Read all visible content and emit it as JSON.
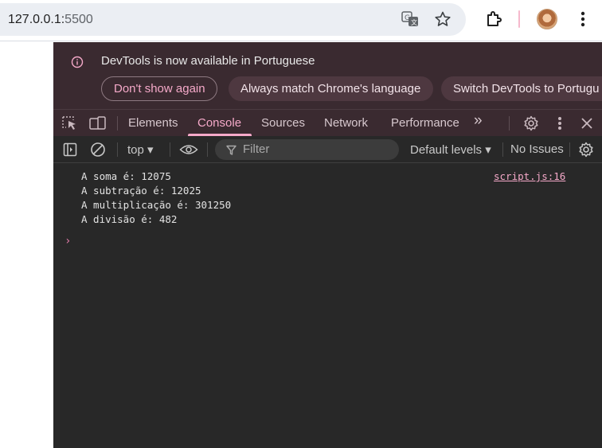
{
  "browser": {
    "url_host": "127.0.0.1:",
    "url_port": "5500",
    "icons": [
      "translate-icon",
      "star-icon",
      "extensions-icon",
      "avatar",
      "kebab-menu-icon"
    ]
  },
  "devtools": {
    "infobar": {
      "message": "DevTools is now available in Portuguese",
      "dont_show_again": "Don't show again",
      "always_match": "Always match Chrome's language",
      "switch_lang": "Switch DevTools to Portugu"
    },
    "tabs": [
      {
        "label": "Elements",
        "active": false
      },
      {
        "label": "Console",
        "active": true
      },
      {
        "label": "Sources",
        "active": false
      },
      {
        "label": "Network",
        "active": false
      },
      {
        "label": "Performance",
        "active": false
      }
    ],
    "more_tabs": "»",
    "console_toolbar": {
      "context": "top ▾",
      "filter_placeholder": "Filter",
      "levels": "Default levels ▾",
      "issues": "No Issues"
    },
    "console": {
      "source": "script.js:16",
      "lines": [
        "A soma é: 12075",
        "A subtração é: 12025",
        "A multiplicação é: 301250",
        "A divisão é: 482"
      ],
      "prompt": "›"
    }
  },
  "colors": {
    "accent": "#f5a9c9",
    "infobar_bg": "#3a2a30",
    "console_bg": "#282828"
  }
}
